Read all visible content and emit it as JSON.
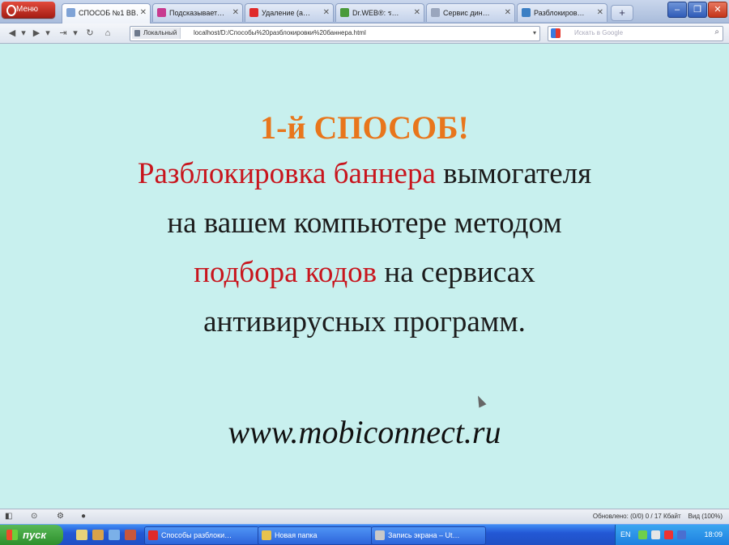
{
  "browser": {
    "menu_button_label": "Меню",
    "tabs": [
      {
        "label": "СПОСОБ №1 ВВ…",
        "favicon_color": "#7fa3d6",
        "active": true
      },
      {
        "label": "Подсказывает…",
        "favicon_color": "#c83a8f",
        "active": false
      },
      {
        "label": "Удаление (а…",
        "favicon_color": "#e02a2a",
        "active": false
      },
      {
        "label": "Dr.WEB®: ร…",
        "favicon_color": "#4a9a3a",
        "active": false
      },
      {
        "label": "Сервис дин…",
        "favicon_color": "#9aa6bd",
        "active": false
      },
      {
        "label": "Разблокиров…",
        "favicon_color": "#3b7fc4",
        "active": false
      }
    ],
    "new_tab_label": "+",
    "window_buttons": [
      "–",
      "❐",
      "✕"
    ],
    "address": {
      "site_label": "Локальный",
      "url": "localhost/D:/Способы%20разблокировки%20баннера.html"
    },
    "search": {
      "placeholder": "Искать в Google"
    }
  },
  "page": {
    "heading": "1-й СПОСОБ!",
    "line1_red": "Разблокировка баннера",
    "line1_rest": " вымогателя",
    "line2": "на вашем компьютере методом",
    "line3_red": "подбора кодов",
    "line3_rest": " на сервисах",
    "line4": "антивирусных программ.",
    "website": "www.mobiconnect.ru",
    "colors": {
      "background": "#c8f0ee",
      "heading": "#e8761c",
      "highlight": "#c8151d"
    }
  },
  "status_bar": {
    "left_icons": [
      "panel-toggle-icon",
      "speed-dial-icon",
      "settings-icon",
      "sync-icon"
    ],
    "right_text": "Обновлено: (0/0) 0 / 17 Кбайт",
    "zoom": "Вид (100%)"
  },
  "taskbar": {
    "start_label": "пуск",
    "tasks": [
      {
        "label": "Способы разблоки…",
        "icon_color": "#e02a2a"
      },
      {
        "label": "Новая папка",
        "icon_color": "#e7c24c"
      },
      {
        "label": "Запись экрана – Ut…",
        "icon_color": "#c9c9c9"
      }
    ],
    "tray": {
      "language": "EN",
      "clock": "18:09"
    }
  }
}
